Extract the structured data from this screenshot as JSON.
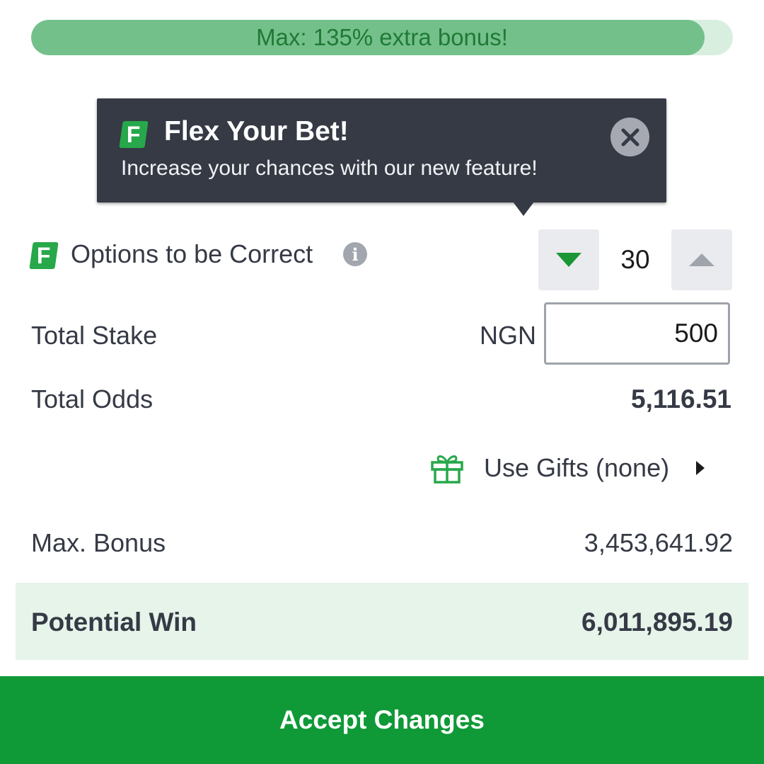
{
  "progress": {
    "label": "Max: 135% extra bonus!",
    "fill_fraction": 0.96,
    "fill_color": "#74c08b",
    "track_color": "#d8efdf"
  },
  "tooltip": {
    "logo_letter": "F",
    "title": "Flex Your Bet!",
    "text": "Increase your chances with our new feature!",
    "close_icon": "close-icon"
  },
  "options": {
    "logo_letter": "F",
    "label": "Options to be Correct",
    "info_icon_glyph": "i",
    "value": "30"
  },
  "stake": {
    "label": "Total Stake",
    "currency": "NGN",
    "value": "500"
  },
  "odds": {
    "label": "Total Odds",
    "value": "5,116.51"
  },
  "gifts": {
    "label": "Use Gifts (none)",
    "icon": "gift-icon"
  },
  "bonus": {
    "label": "Max. Bonus",
    "value": "3,453,641.92"
  },
  "potential_win": {
    "label": "Potential Win",
    "value": "6,011,895.19"
  },
  "accept": {
    "label": "Accept Changes"
  },
  "colors": {
    "brand_green": "#0f9937",
    "dark_panel": "#353a45"
  }
}
